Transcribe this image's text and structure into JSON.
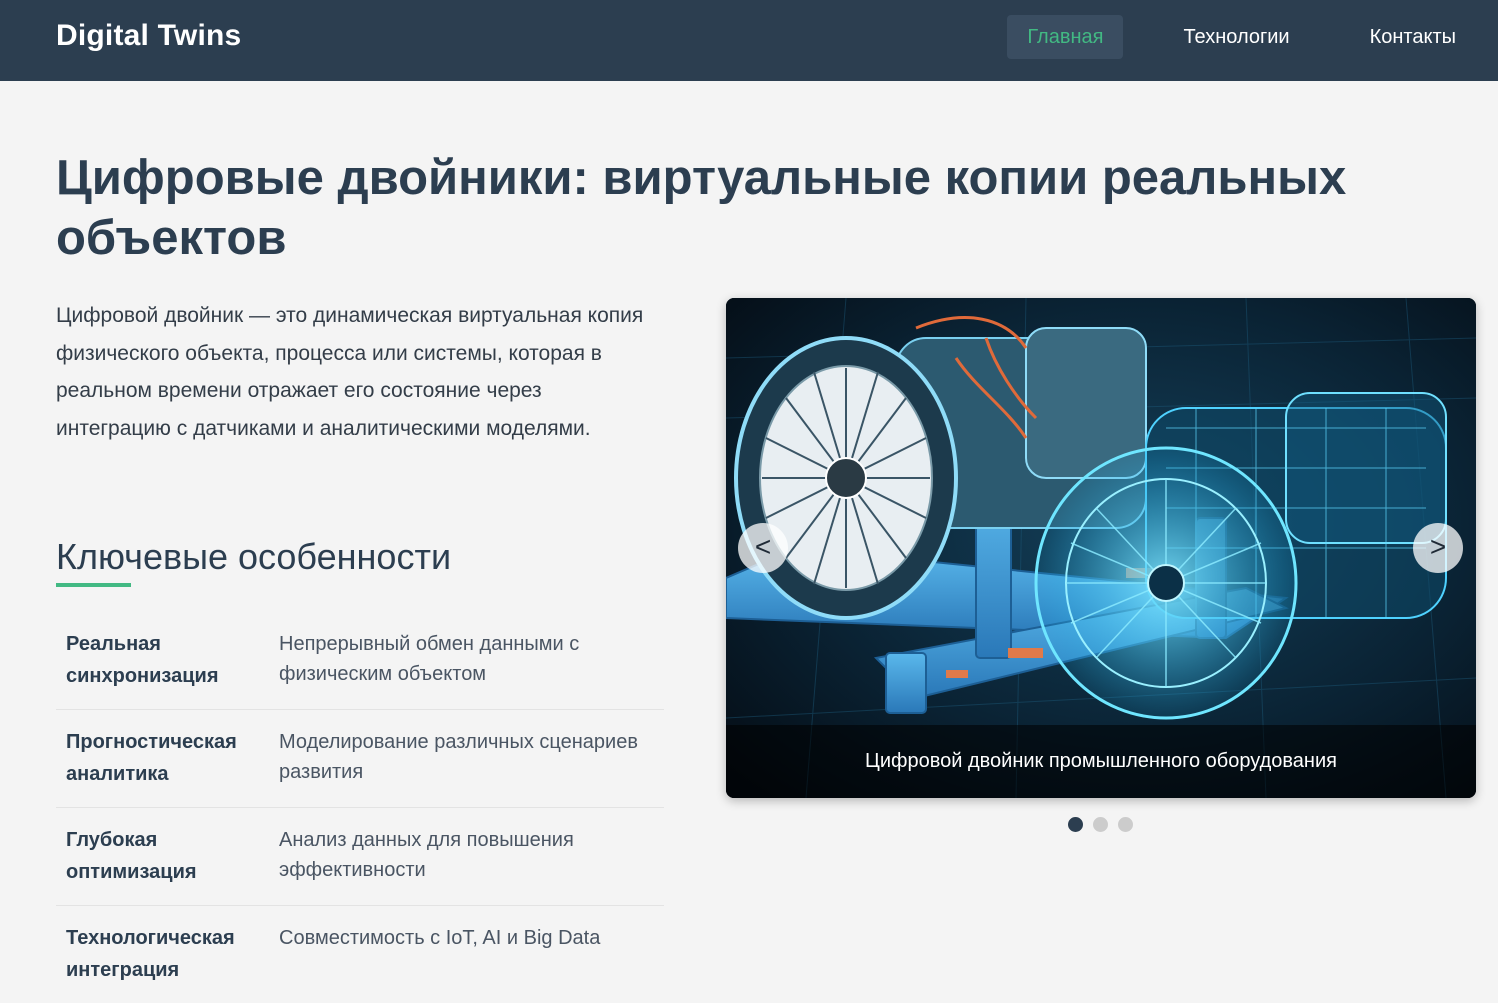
{
  "nav": {
    "brand": "Digital Twins",
    "links": [
      {
        "label": "Главная",
        "active": true
      },
      {
        "label": "Технологии",
        "active": false
      },
      {
        "label": "Контакты",
        "active": false
      }
    ]
  },
  "hero": {
    "title": "Цифровые двойники: виртуальные копии реальных объектов",
    "intro": "Цифровой двойник — это динамическая виртуальная копия физического объекта, процесса или системы, которая в реальном времени отражает его состояние через интеграцию с датчиками и аналитическими моделями."
  },
  "features": {
    "heading": "Ключевые особенности",
    "items": [
      {
        "name": "Реальная синхронизация",
        "description": "Непрерывный обмен данными с физическим объектом"
      },
      {
        "name": "Прогностическая аналитика",
        "description": "Моделирование различных сценариев развития"
      },
      {
        "name": "Глубокая оптимизация",
        "description": "Анализ данных для повышения эффективности"
      },
      {
        "name": "Технологическая интеграция",
        "description": "Совместимость с IoT, AI и Big Data"
      }
    ]
  },
  "slider": {
    "caption": "Цифровой двойник промышленного оборудования",
    "prev_label": "<",
    "next_label": ">",
    "slide_count": 3,
    "active_slide": 1
  },
  "colors": {
    "navbar": "#2c3e50",
    "accent": "#42b983",
    "page_background": "#f4f4f4",
    "hologram": "#2fb8f0"
  }
}
